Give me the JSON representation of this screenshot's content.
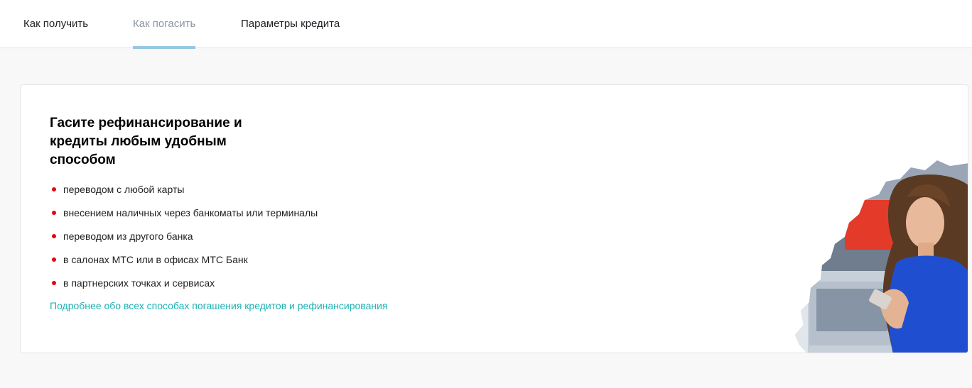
{
  "tabs": [
    {
      "label": "Как получить",
      "active": false
    },
    {
      "label": "Как погасить",
      "active": true
    },
    {
      "label": "Параметры кредита",
      "active": false
    }
  ],
  "card": {
    "title": "Гасите рефинансирование и кредиты любым удобным способом",
    "methods": [
      "переводом с любой карты",
      "внесением наличных через банкоматы или терминалы",
      "переводом из другого банка",
      "в салонах МТС или в офисах МТС Банк",
      "в партнерских точках и сервисах"
    ],
    "more_link": "Подробнее обо всех способах погашения кредитов и рефинансирования"
  },
  "colors": {
    "accent_link": "#1fb2b4",
    "bullet": "#e30611",
    "tab_underline": "#96c8e4",
    "dress": "#1f4fd0"
  }
}
